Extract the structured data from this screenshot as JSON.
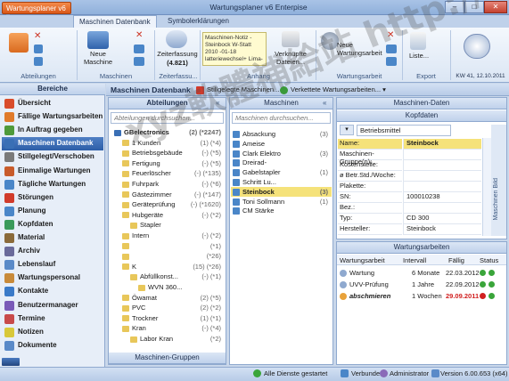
{
  "window": {
    "title": "Wartungsplaner v6 Enterpise",
    "app_menu": "Wartungsplaner v6 ▾",
    "min": "–",
    "max": "□",
    "close": "✕"
  },
  "tabs": [
    "Maschinen Datenbank",
    "Symbolerklärungen"
  ],
  "ribbon": {
    "groups": [
      "Abteilungen",
      "Maschinen",
      "Zeiterfassu...",
      "Anhang",
      "Wartungsarbeit",
      "Export"
    ],
    "new_machine": "Neue\nMaschine",
    "zeiterfassung": "Zeiterfassung",
    "zeit_count": "(4.821)",
    "note": "Maschinen-Notiz - Steinbock W-Statt 2010 -01-18 latteriewechsel+ Lima-",
    "linked_files": "Verknüpfte\nDateien...",
    "new_work": "Neue\nWartungsarbeit",
    "listen": "Liste...",
    "export": "Export",
    "calendar": "KW 41, 12.10.2011"
  },
  "nav": {
    "header": "Bereiche",
    "items": [
      {
        "label": "Übersicht",
        "color": "#d94c2b"
      },
      {
        "label": "Fällige Wartungsarbeiten",
        "color": "#e07b2b"
      },
      {
        "label": "In Auftrag gegeben",
        "color": "#4f9a3a"
      },
      {
        "label": "Maschinen Datenbank",
        "color": "#3a6fb5",
        "selected": true
      },
      {
        "label": "Stillgelegt/Verschoben",
        "color": "#7a7a7a"
      },
      {
        "label": "Einmalige Wartungen",
        "color": "#c85b2b"
      },
      {
        "label": "Tägliche Wartungen",
        "color": "#4a86c8"
      },
      {
        "label": "Störungen",
        "color": "#d13b2b"
      },
      {
        "label": "Planung",
        "color": "#4a86c8"
      },
      {
        "label": "Kopfdaten",
        "color": "#3a9a5a"
      },
      {
        "label": "Material",
        "color": "#8a6a3a"
      },
      {
        "label": "Archiv",
        "color": "#6a6a9a"
      },
      {
        "label": "Lebenslauf",
        "color": "#5a8ac8"
      },
      {
        "label": "Wartungspersonal",
        "color": "#c88a3a"
      },
      {
        "label": "Kontakte",
        "color": "#3a7ac8"
      },
      {
        "label": "Benutzermanager",
        "color": "#7a5ab8"
      },
      {
        "label": "Termine",
        "color": "#c84a4a"
      },
      {
        "label": "Notizen",
        "color": "#d8c83a"
      },
      {
        "label": "Dokumente",
        "color": "#5a8ac8"
      }
    ]
  },
  "content": {
    "title": "Maschinen Datenbank",
    "btn_stillgelegt": "Stillgelegte Maschinen... ▾",
    "btn_verkettete": "Verkettete Wartungsarbeiten... ▾"
  },
  "abteilungen": {
    "header": "Abteilungen",
    "search_placeholder": "Abteilungen durchsuchen...",
    "footer": "Maschinen-Gruppen",
    "rows": [
      {
        "label": "GBelectronics",
        "count": "(2) (*2247)",
        "indent": 0,
        "bold": true
      },
      {
        "label": "1 Kunden",
        "count": "(1) (*4)",
        "indent": 1
      },
      {
        "label": "Betriebsgebäude",
        "count": "(-) (*5)",
        "indent": 1
      },
      {
        "label": "Fertigung",
        "count": "(-) (*5)",
        "indent": 1
      },
      {
        "label": "Feuerlöscher",
        "count": "(-) (*135)",
        "indent": 1
      },
      {
        "label": "Fuhrpark",
        "count": "(-) (*6)",
        "indent": 1
      },
      {
        "label": "Gästezimmer",
        "count": "(-) (*147)",
        "indent": 1
      },
      {
        "label": "Geräteprüfung",
        "count": "(-) (*1620)",
        "indent": 1
      },
      {
        "label": "Hubgeräte",
        "count": "(-) (*2)",
        "indent": 1
      },
      {
        "label": "Stapler",
        "count": "",
        "indent": 2
      },
      {
        "label": "Intern",
        "count": "(-) (*2)",
        "indent": 1
      },
      {
        "label": "",
        "count": "(*1)",
        "indent": 1
      },
      {
        "label": "",
        "count": "(*26)",
        "indent": 1
      },
      {
        "label": "K",
        "count": "(15) (*26)",
        "indent": 1
      },
      {
        "label": "Abfüllkonst...",
        "count": "(-) (*1)",
        "indent": 2
      },
      {
        "label": "WVN 360...",
        "count": "",
        "indent": 3
      },
      {
        "label": "Öwamat",
        "count": "(2) (*5)",
        "indent": 1
      },
      {
        "label": "PVC",
        "count": "(2) (*2)",
        "indent": 1
      },
      {
        "label": "Trockner",
        "count": "(1) (*1)",
        "indent": 1
      },
      {
        "label": "Kran",
        "count": "(-) (*4)",
        "indent": 1
      },
      {
        "label": "Labor Kran",
        "count": "(*2)",
        "indent": 2
      }
    ]
  },
  "maschinen": {
    "header": "Maschinen",
    "search_placeholder": "Maschinen durchsuchen...",
    "rows": [
      {
        "label": "Absackung",
        "count": "(3)"
      },
      {
        "label": "Ameise",
        "count": ""
      },
      {
        "label": "Clark Elektro",
        "count": "(3)"
      },
      {
        "label": "Dreirad-",
        "count": ""
      },
      {
        "label": "Gabelstapler",
        "count": "(1)"
      },
      {
        "label": "Schritt Lu...",
        "count": ""
      },
      {
        "label": "Steinbock",
        "count": "(3)",
        "selected": true
      },
      {
        "label": "Toni Sollmann",
        "count": "(1)"
      },
      {
        "label": "CM Stärke",
        "count": ""
      }
    ]
  },
  "maschinen_daten": {
    "header": "Maschinen-Daten",
    "subheader": "Kopfdaten",
    "dropdown": "Betriebsmittel",
    "side_label": "Maschinen Bild",
    "fields": [
      {
        "label": "Name:",
        "value": "Steinbock",
        "highlight": true
      },
      {
        "label": "Maschinen-Gruppe(n):",
        "value": ""
      },
      {
        "label": "Kostenstelle:",
        "value": ""
      },
      {
        "label": "ø Betr.Std./Woche:",
        "value": ""
      },
      {
        "label": "Plakette:",
        "value": ""
      },
      {
        "label": "SN:",
        "value": "100010238"
      },
      {
        "label": "Bez.:",
        "value": ""
      },
      {
        "label": "Typ:",
        "value": "CD 300"
      },
      {
        "label": "Hersteller:",
        "value": "Steinbock"
      }
    ]
  },
  "wartungsarbeiten": {
    "header": "Wartungsarbeiten",
    "columns": [
      "Wartungsarbeit",
      "Intervall",
      "Fällig",
      "Status"
    ],
    "rows": [
      {
        "name": "Wartung",
        "interval": "6 Monate",
        "due": "22.03.2012",
        "overdue": false,
        "bold": false
      },
      {
        "name": "UVV-Prüfung",
        "interval": "1 Jahre",
        "due": "22.09.2012",
        "overdue": false,
        "bold": false
      },
      {
        "name": "abschmieren",
        "interval": "1 Wochen",
        "due": "29.09.2011",
        "overdue": true,
        "bold": true
      }
    ]
  },
  "status": {
    "services": "Alle Dienste gestartet",
    "connection": "Verbunden",
    "user": "Administrator",
    "version": "Version 6.00.653 (x64)"
  },
  "watermark": "xyz軟體補給站 http://3.to",
  "colors": {
    "accent": "#2d5ea8",
    "overdue": "#d12020"
  }
}
